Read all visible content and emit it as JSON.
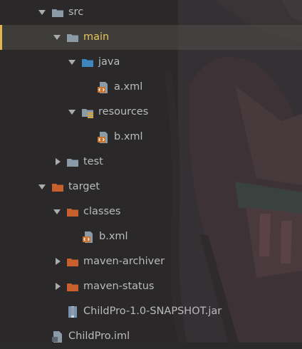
{
  "tree": [
    {
      "label": "src",
      "icon": "folder-icon",
      "color": "#8a9aa6",
      "expanded": true,
      "selected": false
    },
    {
      "label": "main",
      "icon": "folder-icon",
      "color": "#8a9aa6",
      "expanded": true,
      "selected": true
    },
    {
      "label": "java",
      "icon": "source-folder-icon",
      "color": "#3e86c0",
      "expanded": true,
      "selected": false
    },
    {
      "label": "a.xml",
      "icon": "xml-file-icon",
      "color": "#c8732e",
      "expanded": null,
      "selected": false
    },
    {
      "label": "resources",
      "icon": "resources-folder-icon",
      "color": "#8a9aa6",
      "expanded": true,
      "selected": false
    },
    {
      "label": "b.xml",
      "icon": "xml-file-icon",
      "color": "#c8732e",
      "expanded": null,
      "selected": false
    },
    {
      "label": "test",
      "icon": "folder-icon",
      "color": "#8a9aa6",
      "expanded": false,
      "selected": false
    },
    {
      "label": "target",
      "icon": "excluded-folder-icon",
      "color": "#c8602e",
      "expanded": true,
      "selected": false
    },
    {
      "label": "classes",
      "icon": "excluded-folder-icon",
      "color": "#c8602e",
      "expanded": true,
      "selected": false
    },
    {
      "label": "b.xml",
      "icon": "xml-file-icon",
      "color": "#c8732e",
      "expanded": null,
      "selected": false
    },
    {
      "label": "maven-archiver",
      "icon": "excluded-folder-icon",
      "color": "#c8602e",
      "expanded": false,
      "selected": false
    },
    {
      "label": "maven-status",
      "icon": "excluded-folder-icon",
      "color": "#c8602e",
      "expanded": false,
      "selected": false
    },
    {
      "label": "ChildPro-1.0-SNAPSHOT.jar",
      "icon": "jar-file-icon",
      "color": "#7b92ad",
      "expanded": null,
      "selected": false
    },
    {
      "label": "ChildPro.iml",
      "icon": "iml-file-icon",
      "color": "#8a9aa6",
      "expanded": null,
      "selected": false
    }
  ],
  "colors": {
    "background": "#2b2a2b",
    "text": "#b9bcbd",
    "selected_text": "#e8c35a",
    "selection_bar": "#e0b54a"
  }
}
